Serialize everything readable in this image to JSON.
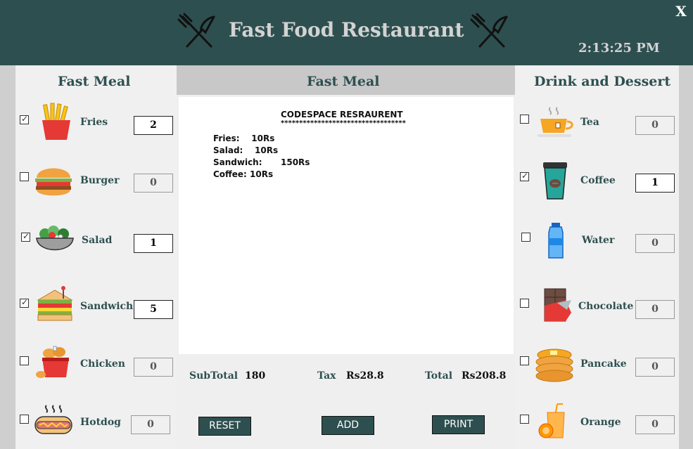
{
  "window": {
    "title": "Fast Food Restaurant",
    "clock": "2:13:25 PM",
    "close_label": "X"
  },
  "left_panel": {
    "title": "Fast Meal",
    "items": [
      {
        "label": "Fries",
        "checked": true,
        "qty": "2",
        "icon": "fries-icon"
      },
      {
        "label": "Burger",
        "checked": false,
        "qty": "0",
        "icon": "burger-icon"
      },
      {
        "label": "Salad",
        "checked": true,
        "qty": "1",
        "icon": "salad-icon"
      },
      {
        "label": "Sandwich",
        "checked": true,
        "qty": "5",
        "icon": "sandwich-icon"
      },
      {
        "label": "Chicken",
        "checked": false,
        "qty": "0",
        "icon": "chicken-icon"
      },
      {
        "label": "Hotdog",
        "checked": false,
        "qty": "0",
        "icon": "hotdog-icon"
      }
    ]
  },
  "center_panel": {
    "title": "Fast Meal",
    "receipt": {
      "heading": "CODESPACE RESRAURENT",
      "separator": "**********************************",
      "lines": [
        "Fries:    10Rs",
        "Salad:    10Rs",
        "Sandwich:",
        "Coffee: 10Rs"
      ],
      "sandwich_price": "150Rs"
    },
    "subtotal_label": "SubTotal",
    "subtotal_value": "180",
    "tax_label": "Tax",
    "tax_value": "Rs28.8",
    "total_label": "Total",
    "total_value": "Rs208.8",
    "buttons": {
      "reset": "RESET",
      "add": "ADD",
      "print": "PRINT"
    }
  },
  "right_panel": {
    "title": "Drink and Dessert",
    "items": [
      {
        "label": "Tea",
        "checked": false,
        "qty": "0",
        "icon": "tea-icon"
      },
      {
        "label": "Coffee",
        "checked": true,
        "qty": "1",
        "icon": "coffee-icon"
      },
      {
        "label": "Water",
        "checked": false,
        "qty": "0",
        "icon": "water-bottle-icon"
      },
      {
        "label": "Chocolate",
        "checked": false,
        "qty": "0",
        "icon": "chocolate-icon"
      },
      {
        "label": "Pancake",
        "checked": false,
        "qty": "0",
        "icon": "pancake-icon"
      },
      {
        "label": "Orange",
        "checked": false,
        "qty": "0",
        "icon": "orange-juice-icon"
      }
    ]
  },
  "colors": {
    "header_bg": "#2e4f4f",
    "title_text": "#d3d3d3",
    "label_text": "#2e4f4f",
    "button_bg": "#2e4f4f"
  }
}
